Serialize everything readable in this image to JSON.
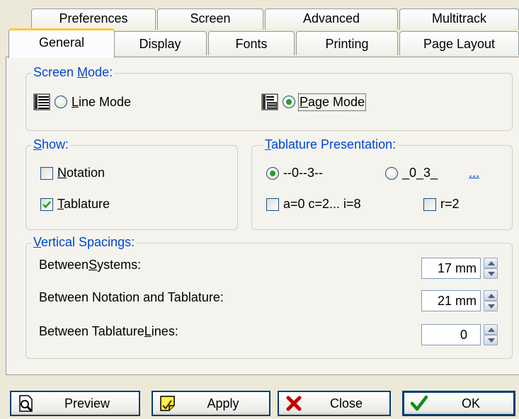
{
  "tabs_back": [
    {
      "label": "Preferences"
    },
    {
      "label": "Screen"
    },
    {
      "label": "Advanced"
    },
    {
      "label": "Multitrack"
    }
  ],
  "tabs_front": [
    {
      "label": "General"
    },
    {
      "label": "Display"
    },
    {
      "label": "Fonts"
    },
    {
      "label": "Printing"
    },
    {
      "label": "Page Layout"
    }
  ],
  "screen_mode": {
    "legend_prefix": "Screen ",
    "legend_key": "M",
    "legend_suffix": "ode:",
    "line_mode_key": "L",
    "line_mode_rest": "ine Mode",
    "page_mode_key": "P",
    "page_mode_rest": "age Mode",
    "selected": "Page Mode"
  },
  "show": {
    "legend_key": "S",
    "legend_rest": "how:",
    "notation_key": "N",
    "notation_rest": "otation",
    "notation_checked": false,
    "tablature_key": "T",
    "tablature_rest": "ablature",
    "tablature_checked": true
  },
  "tablature_presentation": {
    "legend_key": "T",
    "legend_rest": "ablature Presentation:",
    "option1": "--0--3--",
    "option2": "_0_3_",
    "more_link": "...",
    "selected": "--0--3--",
    "check1": "a=0 c=2... i=8",
    "check1_checked": false,
    "check2": "r=2",
    "check2_checked": false
  },
  "vertical_spacings": {
    "legend_key": "V",
    "legend_rest": "ertical Spacings:",
    "rows": [
      {
        "pre": "Between ",
        "key": "S",
        "post": "ystems:",
        "value": "17 mm"
      },
      {
        "pre": "Between Notation and Tablature:",
        "key": "",
        "post": "",
        "value": "21 mm"
      },
      {
        "pre": "Between Tablature ",
        "key": "L",
        "post": "ines:",
        "value": "0"
      }
    ]
  },
  "buttons": {
    "preview": "Preview",
    "apply": "Apply",
    "close": "Close",
    "ok": "OK"
  },
  "colors": {
    "legend_text": "#0046d5",
    "active_tab_highlight": "#ffc83c",
    "radio_dot": "#21a121",
    "check_mark": "#21a121",
    "close_x": "#c00000"
  }
}
